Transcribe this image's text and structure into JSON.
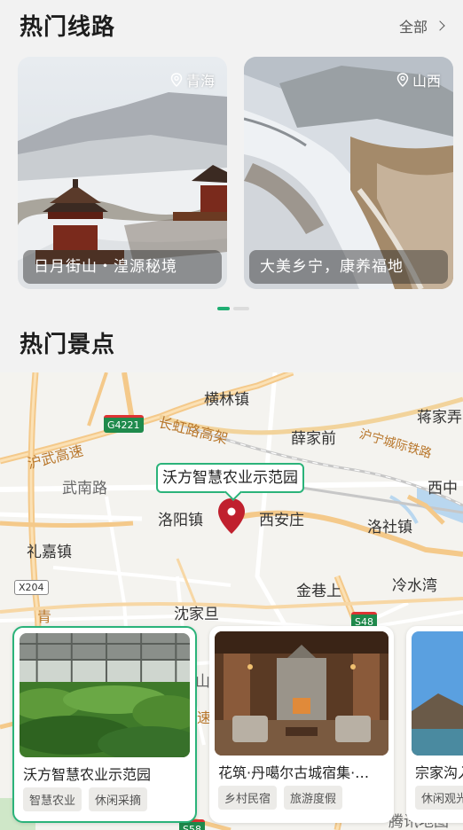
{
  "hot_routes": {
    "title": "热门线路",
    "more_label": "全部",
    "cards": [
      {
        "location": "青海",
        "caption": "日月街山・湟源秘境"
      },
      {
        "location": "山西",
        "caption": "大美乡宁，康养福地"
      }
    ]
  },
  "hot_spots": {
    "title": "热门景点",
    "map_labels": {
      "hengling": "横林镇",
      "jiangjia": "蒋家弄",
      "g4221": "G4221",
      "changhong": "长虹路高架",
      "xuejiaqian": "薛家前",
      "huning": "沪宁城际铁路",
      "huwu": "沪武高速",
      "wunan": "武南路",
      "xizhong": "西中",
      "luoyang": "洛阳镇",
      "xianzhuang": "西安庄",
      "luoshe": "洛社镇",
      "lijia": "礼嘉镇",
      "x204": "X204",
      "jinxiang": "金巷上",
      "lengshui": "冷水湾",
      "qing": "青",
      "shenjiadan": "沈家旦",
      "s48": "S48",
      "s58": "S58",
      "shan": "山",
      "su": "速",
      "tengxun": "腾讯地图"
    },
    "callout": "沃方智慧农业示范园",
    "spots": [
      {
        "name": "沃方智慧农业示范园",
        "tags": [
          "智慧农业",
          "休闲采摘"
        ]
      },
      {
        "name": "花筑·丹噶尔古城宿集·…",
        "tags": [
          "乡村民宿",
          "旅游度假"
        ]
      },
      {
        "name": "宗家沟入",
        "tags": [
          "休闲观光"
        ]
      }
    ]
  }
}
